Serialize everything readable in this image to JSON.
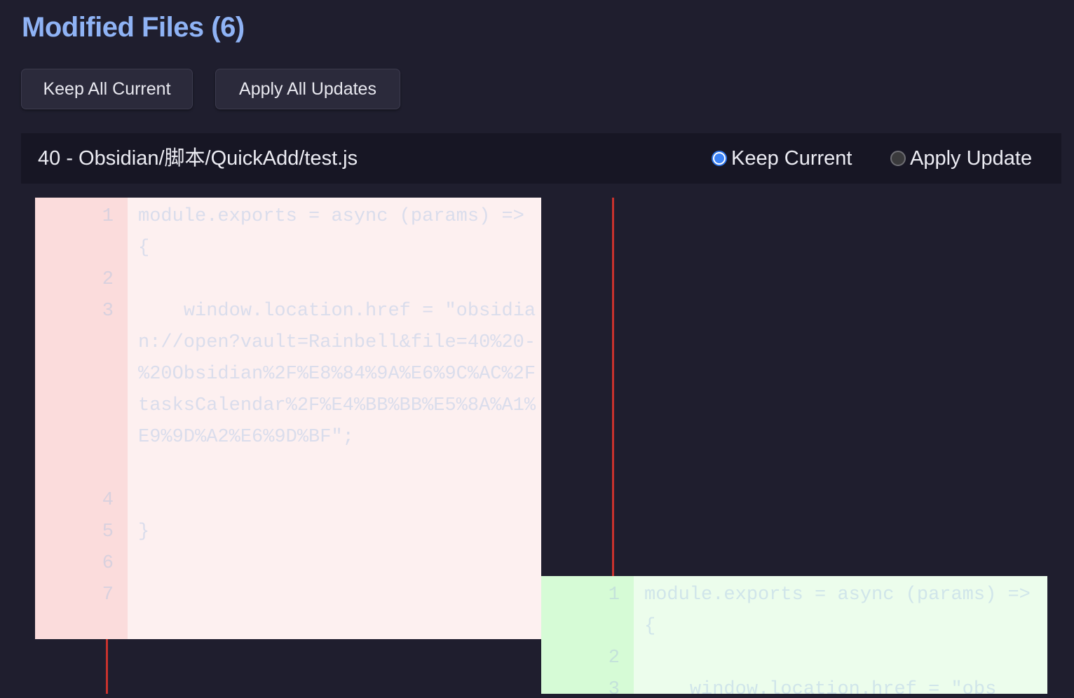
{
  "header": {
    "title": "Modified Files (6)"
  },
  "actions": {
    "keep_all_label": "Keep All Current",
    "apply_all_label": "Apply All Updates"
  },
  "file": {
    "path": "40 - Obsidian/脚本/QuickAdd/test.js",
    "options": {
      "keep_label": "Keep Current",
      "apply_label": "Apply Update",
      "selected": "Keep Current"
    }
  },
  "diff": {
    "current_lines": [
      {
        "num": "1",
        "text": "module.exports = async (params) => {"
      },
      {
        "num": "2",
        "text": ""
      },
      {
        "num": "3",
        "text": "    window.location.href = \"obsidian://open?vault=Rainbell&file=40%20-%20Obsidian%2F%E8%84%9A%E6%9C%AC%2FtasksCalendar%2F%E4%BB%BB%E5%8A%A1%E9%9D%A2%E6%9D%BF\";"
      },
      {
        "num": "4",
        "text": ""
      },
      {
        "num": "5",
        "text": "}"
      },
      {
        "num": "6",
        "text": ""
      },
      {
        "num": "7",
        "text": ""
      }
    ],
    "update_lines": [
      {
        "num": "1",
        "text": "module.exports = async (params) => {"
      },
      {
        "num": "2",
        "text": ""
      },
      {
        "num": "3",
        "text": "    window.location.href = \"obs"
      }
    ]
  },
  "colors": {
    "title": "#8fb3f5",
    "background": "#1f1e2e",
    "removed_bg": "#fdf0f0",
    "added_bg": "#ecfdec",
    "connector": "#c8322d",
    "radio_accent": "#3b82f6"
  }
}
